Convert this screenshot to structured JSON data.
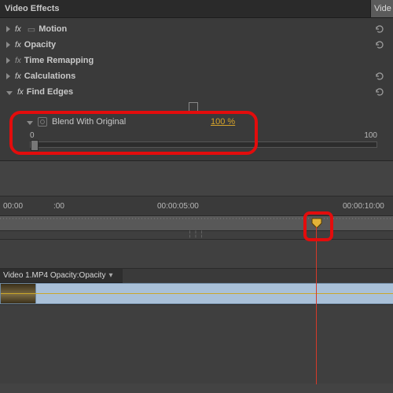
{
  "panel": {
    "title": "Video Effects",
    "tab_stub": "Vide",
    "items": [
      {
        "fx": true,
        "label": "Motion",
        "bold": true,
        "reset": true
      },
      {
        "fx": true,
        "label": "Opacity",
        "bold": true,
        "reset": true
      },
      {
        "fx": false,
        "label": "Time Remapping",
        "bold": true,
        "reset": false
      },
      {
        "fx": true,
        "label": "Calculations",
        "bold": true,
        "reset": true
      }
    ],
    "find_edges": {
      "label": "Find Edges",
      "blend_label": "Blend With Original",
      "blend_value": "100 %",
      "slider_min": "0",
      "slider_max": "100"
    }
  },
  "timeline": {
    "ticks": [
      "00:00",
      ":00",
      "00:00:05:00",
      "00:00:10:00"
    ],
    "clip_name": "Video 1.MP4",
    "clip_prop": "Opacity:Opacity",
    "clip_dd": "▾"
  }
}
